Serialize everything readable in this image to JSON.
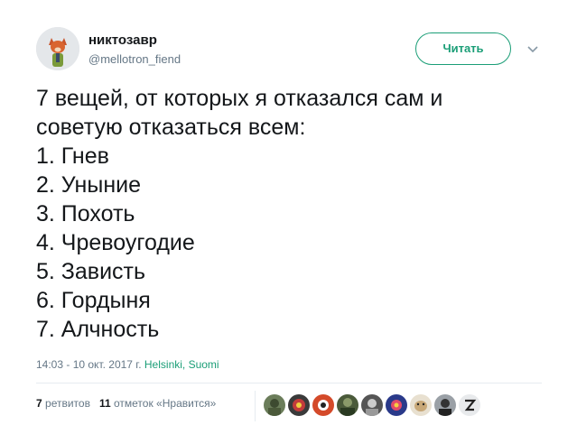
{
  "author": {
    "name": "никтозавр",
    "handle": "@mellotron_fiend"
  },
  "follow_button": {
    "label": "Читать"
  },
  "tweet": {
    "lines": [
      "7 вещей, от которых я отказался сам и",
      "советую отказаться всем:",
      "1. Гнев",
      "2. Уныние",
      "3. Похоть",
      "4. Чревоугодие",
      "5. Зависть",
      "6. Гордыня",
      "7. Алчность"
    ]
  },
  "meta": {
    "timestamp": "14:03 - 10 окт. 2017 г.",
    "location": "Helsinki, Suomi"
  },
  "stats": {
    "retweets_count": "7",
    "retweets_label": "ретвитов",
    "likes_count": "11",
    "likes_label": "отметок «Нравится»"
  },
  "colors": {
    "accent": "#1b9e77",
    "text": "#14171a",
    "muted": "#657786"
  },
  "likers": [
    "avatar-1",
    "avatar-2",
    "avatar-3",
    "avatar-4",
    "avatar-5",
    "avatar-6",
    "avatar-7",
    "avatar-8",
    "avatar-9"
  ]
}
